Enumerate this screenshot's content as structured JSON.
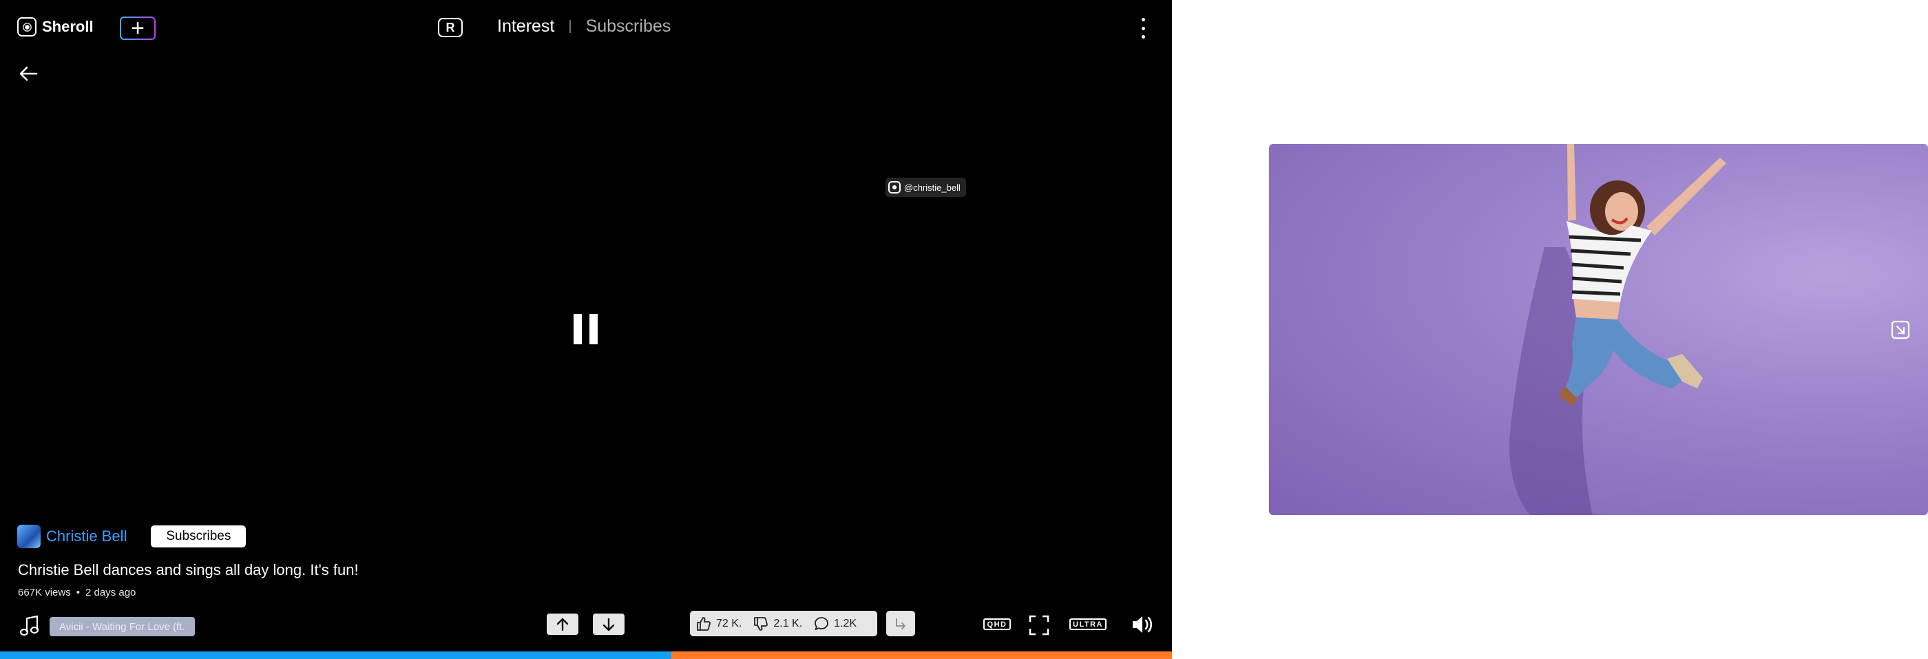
{
  "app": {
    "brand": "Sheroll",
    "r_badge": "R",
    "tabs": [
      {
        "label": "Interest",
        "active": true
      },
      {
        "label": "Subscribes",
        "active": false
      }
    ]
  },
  "video": {
    "overlay_handle": "@christie_bell",
    "channel_name": "Christie Bell",
    "subscribe_label": "Subscribes",
    "title": "Christie Bell dances and sings all day long. It's fun!",
    "views": "667K views",
    "age": "2 days ago",
    "song": "Avicii - Waiting For Love (ft.",
    "likes": "72 K.",
    "dislikes": "2.1 K.",
    "comments": "1.2K",
    "quality_badge": "QHD",
    "ultra_badge": "ULTRA",
    "progress_fraction": 0.573
  },
  "colors": {
    "accent_blue": "#13a0f2",
    "accent_orange": "#ff7a29",
    "channel_blue": "#3aa0ff",
    "preview_purple": "#9c83cc"
  },
  "icons": [
    "logo-icon",
    "create-icon",
    "more-icon",
    "back-arrow-icon",
    "pause-icon",
    "music-note-icon",
    "arrow-up-icon",
    "arrow-down-icon",
    "thumbs-up-icon",
    "thumbs-down-icon",
    "comment-icon",
    "share-icon",
    "fullscreen-icon",
    "volume-icon",
    "expand-icon"
  ]
}
